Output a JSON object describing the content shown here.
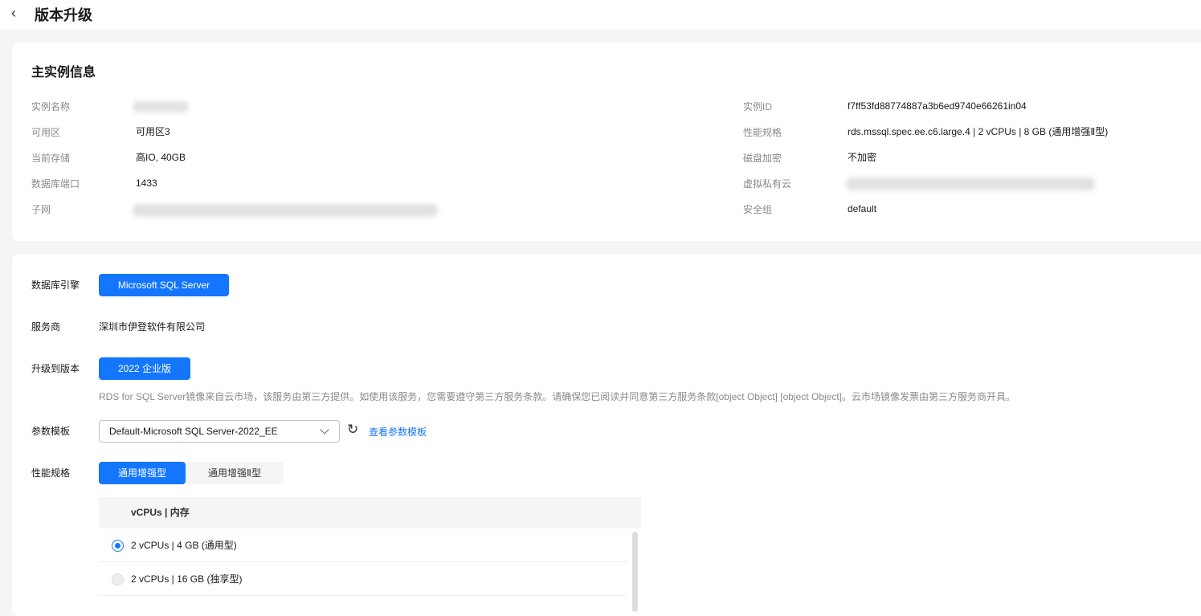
{
  "header": {
    "title": "版本升级"
  },
  "instance_info": {
    "title": "主实例信息",
    "left": [
      {
        "label": "实例名称",
        "value": null,
        "blurred": true
      },
      {
        "label": "可用区",
        "value": "可用区3"
      },
      {
        "label": "当前存储",
        "value": "高IO, 40GB"
      },
      {
        "label": "数据库端口",
        "value": "1433"
      },
      {
        "label": "子网",
        "value": null,
        "blurred": true
      }
    ],
    "right": [
      {
        "label": "实例ID",
        "value": "f7ff53fd88774887a3b6ed9740e66261in04"
      },
      {
        "label": "性能规格",
        "value": "rds.mssql.spec.ee.c6.large.4 | 2 vCPUs | 8 GB (通用增强Ⅱ型)"
      },
      {
        "label": "磁盘加密",
        "value": "不加密"
      },
      {
        "label": "虚拟私有云",
        "value": null,
        "blurred": true
      },
      {
        "label": "安全组",
        "value": "default"
      }
    ]
  },
  "form": {
    "engine_label": "数据库引擎",
    "engine_value": "Microsoft SQL Server",
    "provider_label": "服务商",
    "provider_value": "深圳市伊登软件有限公司",
    "version_label": "升级到版本",
    "version_value": "2022 企业版",
    "version_note": "RDS for SQL Server镜像来自云市场，该服务由第三方提供。如使用该服务，您需要遵守第三方服务条款。请确保您已阅读并同意第三方服务条款[object Object] [object Object]。云市场镜像发票由第三方服务商开具。",
    "param_label": "参数模板",
    "param_value": "Default-Microsoft SQL Server-2022_EE",
    "param_link": "查看参数模板",
    "spec_label": "性能规格",
    "spec_tabs": [
      {
        "label": "通用增强型",
        "active": true
      },
      {
        "label": "通用增强Ⅱ型",
        "active": false
      }
    ],
    "table_header": "vCPUs | 内存",
    "table_rows": [
      {
        "label": "2 vCPUs | 4 GB (通用型)",
        "selected": true
      },
      {
        "label": "2 vCPUs | 16 GB (独享型)",
        "selected": false
      }
    ]
  },
  "colors": {
    "accent": "#1476ff"
  }
}
